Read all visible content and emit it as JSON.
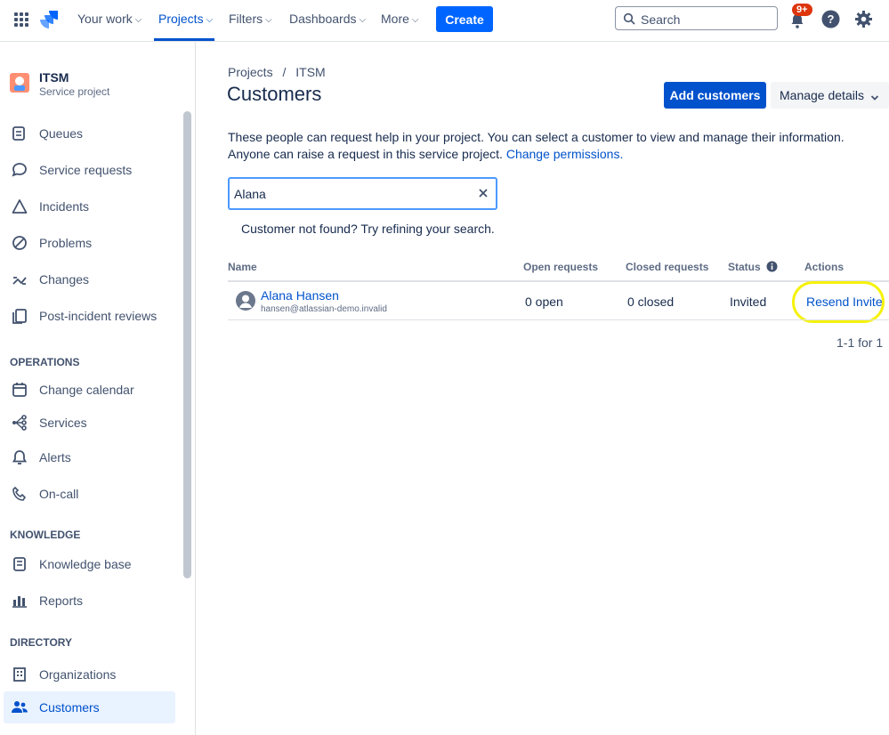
{
  "topnav": {
    "your_work": "Your work",
    "projects": "Projects",
    "filters": "Filters",
    "dashboards": "Dashboards",
    "more": "More",
    "create": "Create",
    "search_placeholder": "Search",
    "notifications_badge": "9+"
  },
  "project": {
    "name": "ITSM",
    "type": "Service project"
  },
  "sidebar": {
    "items": [
      {
        "label": "Queues"
      },
      {
        "label": "Service requests"
      },
      {
        "label": "Incidents"
      },
      {
        "label": "Problems"
      },
      {
        "label": "Changes"
      },
      {
        "label": "Post-incident reviews"
      }
    ],
    "operations_heading": "OPERATIONS",
    "operations": [
      {
        "label": "Change calendar"
      },
      {
        "label": "Services"
      },
      {
        "label": "Alerts"
      },
      {
        "label": "On-call"
      }
    ],
    "knowledge_heading": "KNOWLEDGE",
    "knowledge": [
      {
        "label": "Knowledge base"
      },
      {
        "label": "Reports"
      }
    ],
    "directory_heading": "DIRECTORY",
    "directory": [
      {
        "label": "Organizations"
      },
      {
        "label": "Customers"
      }
    ]
  },
  "main": {
    "breadcrumb_projects": "Projects",
    "breadcrumb_sep": "/",
    "breadcrumb_project": "ITSM",
    "title": "Customers",
    "add_customers": "Add customers",
    "manage_details": "Manage details",
    "description_line1": "These people can request help in your project. You can select a customer to view and manage their information.",
    "description_line2": "Anyone can raise a request in this service project.",
    "change_permissions": "Change permissions.",
    "search_value": "Alana",
    "not_found_hint": "Customer not found? Try refining your search.",
    "columns": {
      "name": "Name",
      "open": "Open requests",
      "closed": "Closed requests",
      "status": "Status",
      "actions": "Actions"
    },
    "rows": [
      {
        "name": "Alana Hansen",
        "email": "hansen@atlassian-demo.invalid",
        "open": "0 open",
        "closed": "0 closed",
        "status": "Invited",
        "action": "Resend Invite"
      }
    ],
    "pagination": "1-1 for 1"
  },
  "colors": {
    "brand": "#0052CC",
    "create_button": "#0065FF",
    "highlight": "#F5F20C",
    "badge": "#DE350B"
  }
}
